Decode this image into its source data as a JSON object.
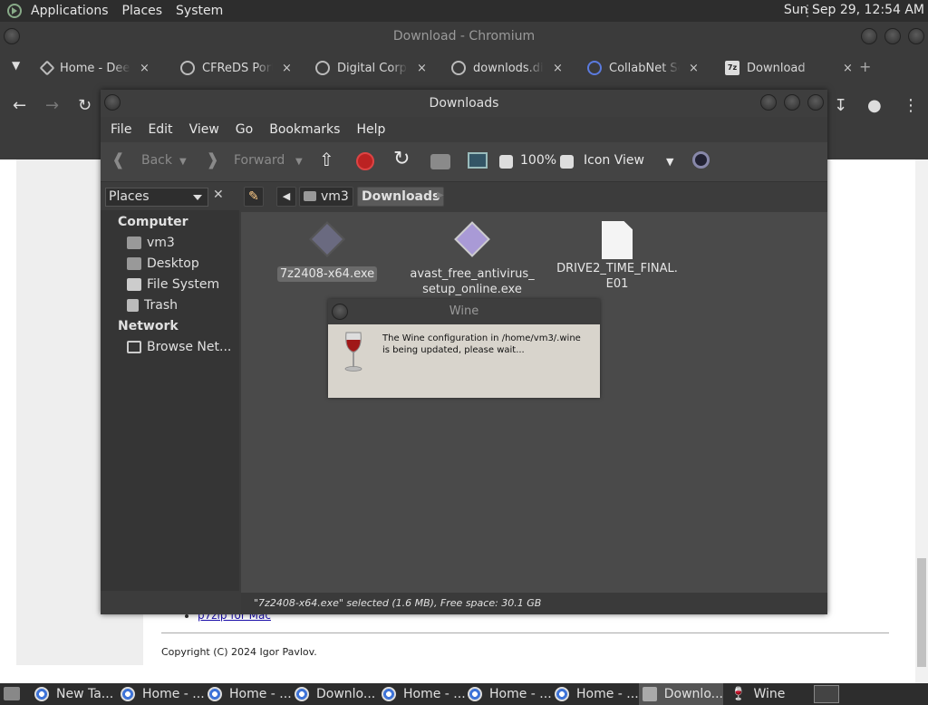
{
  "top_panel": {
    "menus": [
      "Applications",
      "Places",
      "System"
    ],
    "clock": "Sun Sep 29, 12:54 AM"
  },
  "chromium": {
    "title": "Download - Chromium",
    "tabs": [
      {
        "label": "Home - Deep",
        "icon": "deepspar-icon"
      },
      {
        "label": "CFReDS Porta",
        "icon": "globe-icon"
      },
      {
        "label": "Digital Corpo",
        "icon": "globe-icon"
      },
      {
        "label": "downlods.dig",
        "icon": "globe-icon"
      },
      {
        "label": "CollabNet Se",
        "icon": "search-icon"
      },
      {
        "label": "Download",
        "icon": "7zip-icon"
      }
    ],
    "tab_close": "×",
    "new_tab": "+",
    "page": {
      "link": "p7zip for Mac",
      "copyright": "Copyright (C) 2024 Igor Pavlov."
    }
  },
  "file_manager": {
    "title": "Downloads",
    "menu": [
      "File",
      "Edit",
      "View",
      "Go",
      "Bookmarks",
      "Help"
    ],
    "toolbar": {
      "back": "Back",
      "forward": "Forward",
      "zoom": "100%",
      "view_mode": "Icon View"
    },
    "places_label": "Places",
    "sidebar": {
      "computer_heading": "Computer",
      "computer_items": [
        "vm3",
        "Desktop",
        "File System",
        "Trash"
      ],
      "network_heading": "Network",
      "network_items": [
        "Browse Net..."
      ]
    },
    "path": [
      "vm3",
      "Downloads"
    ],
    "files": [
      {
        "name": "7z2408-x64.exe",
        "selected": true
      },
      {
        "name": "avast_free_antivirus_\nsetup_online.exe",
        "selected": false
      },
      {
        "name": "DRIVE2_TIME_FINAL.\nE01",
        "selected": false
      }
    ],
    "status": "\"7z2408-x64.exe\" selected (1.6 MB), Free space: 30.1 GB"
  },
  "wine_dialog": {
    "title": "Wine",
    "message": "The Wine configuration in /home/vm3/.wine is being updated, please wait..."
  },
  "taskbar": {
    "items": [
      {
        "label": "New Ta...",
        "icon": "chromium-icon"
      },
      {
        "label": "Home - ...",
        "icon": "chromium-icon"
      },
      {
        "label": "Home - ...",
        "icon": "chromium-icon"
      },
      {
        "label": "Downlo...",
        "icon": "chromium-icon"
      },
      {
        "label": "Home - ...",
        "icon": "chromium-icon"
      },
      {
        "label": "Home - ...",
        "icon": "chromium-icon"
      },
      {
        "label": "Home - ...",
        "icon": "chromium-icon"
      },
      {
        "label": "Downlo...",
        "icon": "folder-icon"
      },
      {
        "label": "Wine",
        "icon": "wine-glass-icon"
      }
    ]
  }
}
